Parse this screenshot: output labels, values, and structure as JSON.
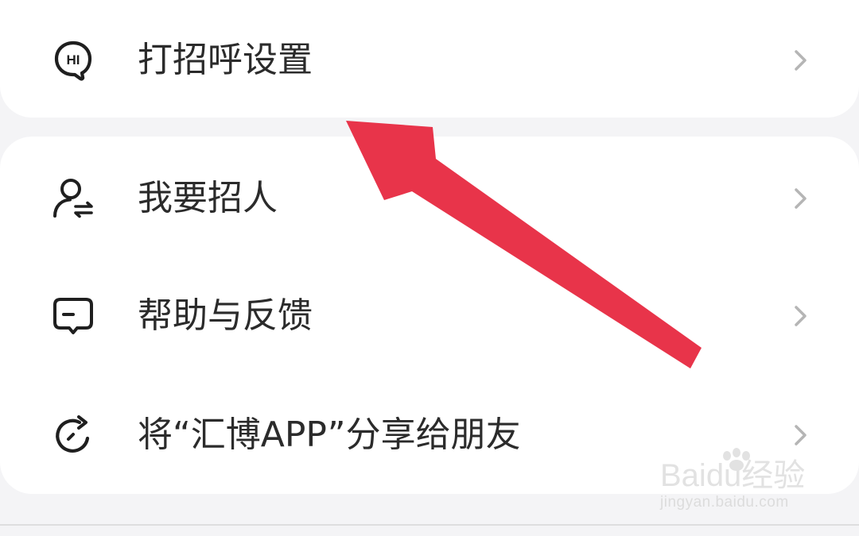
{
  "menu": {
    "greeting_settings": {
      "label": "打招呼设置",
      "icon": "hi-chat-icon"
    },
    "recruit": {
      "label": "我要招人",
      "icon": "user-exchange-icon"
    },
    "help_feedback": {
      "label": "帮助与反馈",
      "icon": "feedback-chat-icon"
    },
    "share_app": {
      "label": "将“汇博APP”分享给朋友",
      "icon": "share-refresh-icon"
    }
  },
  "icon_text": {
    "hi": "HI"
  },
  "annotation": {
    "arrow_color": "#e8344a"
  },
  "watermark": {
    "brand": "Baidu经验",
    "url": "jingyan.baidu.com"
  },
  "colors": {
    "background": "#f4f4f6",
    "card": "#ffffff",
    "text": "#2b2b2b",
    "chevron": "#b5b5b5"
  }
}
